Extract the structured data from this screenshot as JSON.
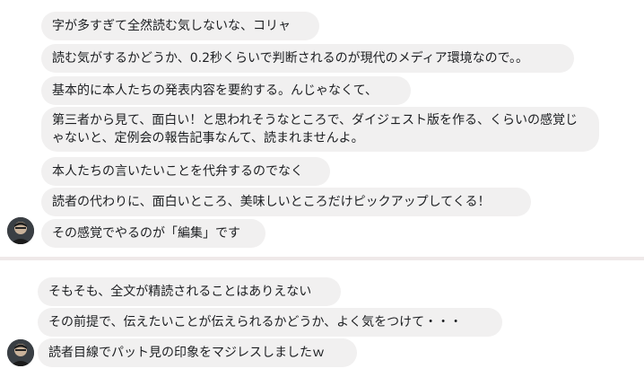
{
  "thread_top": {
    "messages": [
      "字が多すぎて全然読む気しないな、コリャ",
      "読む気がするかどうか、0.2秒くらいで判断されるのが現代のメディア環境なので。。",
      "基本的に本人たちの発表内容を要約する。んじゃなくて、",
      "第三者から見て、面白い！と思われそうなところで、ダイジェスト版を作る、くらいの感覚じゃないと、定例会の報告記事なんて、読まれませんよ。",
      "本人たちの言いたいことを代弁するのでなく",
      "読者の代わりに、面白いところ、美味しいところだけピックアップしてくる！",
      "その感覚でやるのが「編集」です"
    ]
  },
  "thread_bottom": {
    "messages": [
      "そもそも、全文が精読されることはありえない",
      "その前提で、伝えたいことが伝えられるかどうか、よく気をつけて・・・",
      "読者目線でパット見の印象をマジレスしましたｗ"
    ]
  }
}
